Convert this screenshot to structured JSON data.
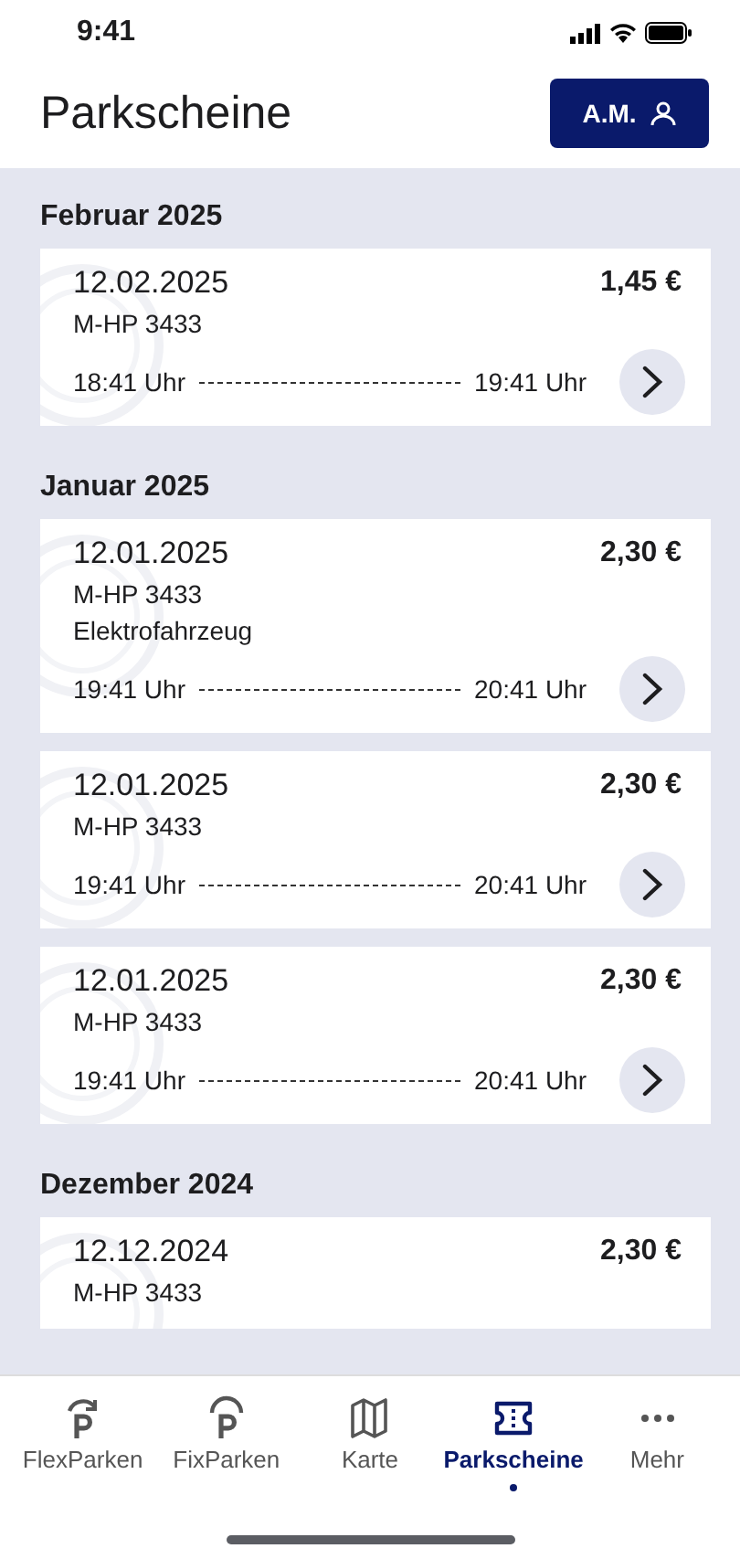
{
  "status_bar": {
    "time": "9:41"
  },
  "header": {
    "title": "Parkscheine",
    "account_button": "A.M."
  },
  "sections": [
    {
      "month": "Februar 2025",
      "tickets": [
        {
          "date": "12.02.2025",
          "price": "1,45 €",
          "plate": "M-HP 3433",
          "start": "18:41 Uhr",
          "end": "19:41 Uhr"
        }
      ]
    },
    {
      "month": "Januar 2025",
      "tickets": [
        {
          "date": "12.01.2025",
          "price": "2,30 €",
          "plate": "M-HP 3433",
          "note": "Elektrofahrzeug",
          "start": "19:41 Uhr",
          "end": "20:41 Uhr"
        },
        {
          "date": "12.01.2025",
          "price": "2,30 €",
          "plate": "M-HP 3433",
          "start": "19:41 Uhr",
          "end": "20:41 Uhr"
        },
        {
          "date": "12.01.2025",
          "price": "2,30 €",
          "plate": "M-HP 3433",
          "start": "19:41 Uhr",
          "end": "20:41 Uhr"
        }
      ]
    },
    {
      "month": "Dezember 2024",
      "tickets": [
        {
          "date": "12.12.2024",
          "price": "2,30 €",
          "plate": "M-HP 3433"
        }
      ]
    }
  ],
  "tab_bar": [
    {
      "label": "FlexParken",
      "kind": "flex",
      "selected": false
    },
    {
      "label": "FixParken",
      "kind": "fix",
      "selected": false
    },
    {
      "label": "Karte",
      "kind": "map",
      "selected": false
    },
    {
      "label": "Parkscheine",
      "kind": "ticket",
      "selected": true
    },
    {
      "label": "Mehr",
      "kind": "more",
      "selected": false
    }
  ]
}
